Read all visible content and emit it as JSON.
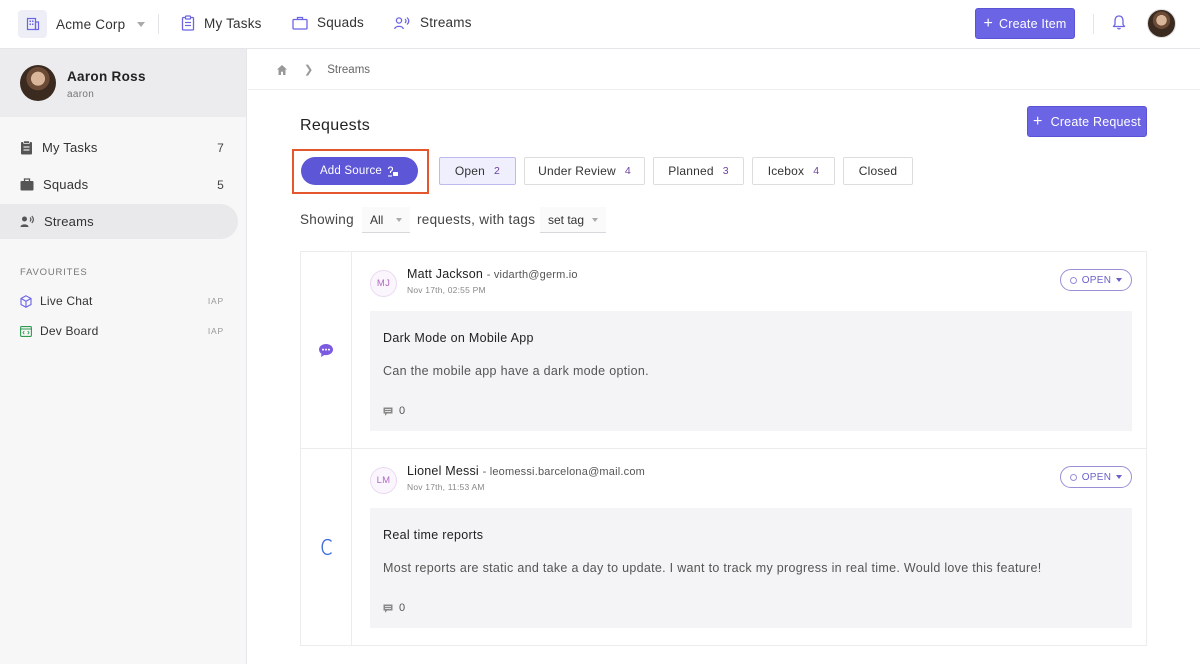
{
  "header": {
    "org_name": "Acme Corp",
    "nav": [
      {
        "label": "My Tasks",
        "icon": "clipboard-icon"
      },
      {
        "label": "Squads",
        "icon": "briefcase-icon"
      },
      {
        "label": "Streams",
        "icon": "streams-icon"
      }
    ],
    "create_item_label": "Create Item"
  },
  "sidebar": {
    "user_name": "Aaron Ross",
    "user_handle": "aaron",
    "items": [
      {
        "label": "My Tasks",
        "count": "7"
      },
      {
        "label": "Squads",
        "count": "5"
      },
      {
        "label": "Streams",
        "count": ""
      }
    ],
    "favourites_title": "FAVOURITES",
    "favourites": [
      {
        "label": "Live Chat",
        "tag": "IAP"
      },
      {
        "label": "Dev Board",
        "tag": "IAP"
      }
    ]
  },
  "breadcrumb": {
    "current": "Streams"
  },
  "main": {
    "title": "Requests",
    "create_request_label": "Create Request",
    "add_source_label": "Add Source",
    "filters": [
      {
        "label": "Open",
        "count": "2"
      },
      {
        "label": "Under Review",
        "count": "4"
      },
      {
        "label": "Planned",
        "count": "3"
      },
      {
        "label": "Icebox",
        "count": "4"
      },
      {
        "label": "Closed",
        "count": ""
      }
    ],
    "showing_label": "Showing",
    "showing_value": "All",
    "with_tags_label": "requests, with tags",
    "tag_value": "set tag"
  },
  "requests": [
    {
      "initials": "MJ",
      "author": "Matt Jackson",
      "email": "- vidarth@germ.io",
      "date": "Nov 17th, 02:55 PM",
      "status": "OPEN",
      "title": "Dark Mode on Mobile App",
      "body": "Can the mobile app have a dark mode option.",
      "comments": "0",
      "source_icon": "chat-bubble-icon"
    },
    {
      "initials": "LM",
      "author": "Lionel Messi",
      "email": "- leomessi.barcelona@mail.com",
      "date": "Nov 17th, 11:53 AM",
      "status": "OPEN",
      "title": "Real time reports",
      "body": "Most reports are static and take a day to update. I want to track my progress in real time. Would love this feature!",
      "comments": "0",
      "source_icon": "c-letter-icon"
    }
  ],
  "colors": {
    "accent": "#6b64e4",
    "highlight": "#e4562e",
    "badge_text": "#6b3fa0"
  }
}
